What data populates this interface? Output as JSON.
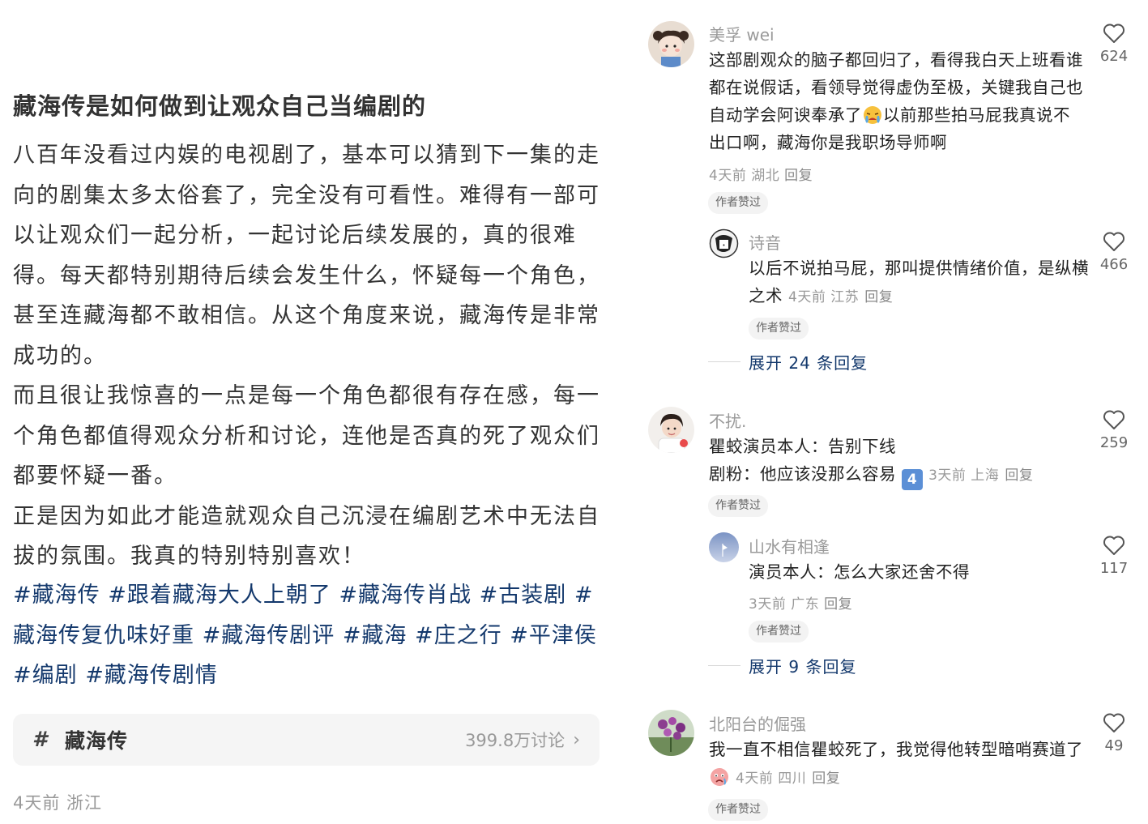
{
  "post": {
    "title": "藏海传是如何做到让观众自己当编剧的",
    "paragraphs": [
      "八百年没看过内娱的电视剧了，基本可以猜到下一集的走向的剧集太多太俗套了，完全没有可看性。难得有一部可以让观众们一起分析，一起讨论后续发展的，真的很难得。每天都特别期待后续会发生什么，怀疑每一个角色，甚至连藏海都不敢相信。从这个角度来说，藏海传是非常成功的。",
      "而且很让我惊喜的一点是每一个角色都很有存在感，每一个角色都值得观众分析和讨论，连他是否真的死了观众们都要怀疑一番。",
      "正是因为如此才能造就观众自己沉浸在编剧艺术中无法自拔的氛围。我真的特别特别喜欢！"
    ],
    "tags": [
      "#藏海传",
      "#跟着藏海大人上朝了",
      "#藏海传肖战",
      "#古装剧",
      "#藏海传复仇味好重",
      "#藏海传剧评",
      "#藏海",
      "#庄之行",
      "#平津侯",
      "#编剧",
      "#藏海传剧情"
    ],
    "topic": {
      "hash_icon": "hash-icon",
      "name": "藏海传",
      "count": "399.8万讨论",
      "chevron": "›"
    },
    "meta": "4天前 浙江"
  },
  "comments": {
    "reply_label": "回复",
    "author_liked": "作者赞过",
    "c1": {
      "name": "美孚 wei",
      "text_a": "这部剧观众的脑子都回归了，看得我白天上班看谁都在说假话，看领导觉得虚伪至极，关键我自己也自动学会阿谀奉承了",
      "text_b": "以前那些拍马屁我真说不出口啊，藏海你是我职场导师啊",
      "emoji": "crying-emoji",
      "meta": "4天前 湖北",
      "likes": "624",
      "reply": {
        "name": "诗音",
        "text": "以后不说拍马屁，那叫提供情绪价值，是纵横之术",
        "meta": "4天前 江苏",
        "likes": "466"
      },
      "expand": "展开 24 条回复"
    },
    "c2": {
      "name": "不扰.",
      "line1": "瞿蛟演员本人：告别下线",
      "line2": "剧粉：他应该没那么容易",
      "emoji": "keycap-4-emoji",
      "emoji_text": "4",
      "meta": "3天前 上海",
      "likes": "259",
      "reply": {
        "name": "山水有相逢",
        "text": "演员本人：怎么大家还舍不得",
        "meta": "3天前 广东",
        "likes": "117"
      },
      "expand": "展开 9 条回复"
    },
    "c3": {
      "name": "北阳台的倔强",
      "text_a": "我一直不相信瞿蛟死了，我觉得他转型暗哨赛道了",
      "emoji": "sad-face-emoji",
      "meta": "4天前 四川",
      "likes": "49"
    }
  },
  "colors": {
    "tag": "#13386c",
    "meta": "#999999",
    "name": "#9a9a9a"
  }
}
